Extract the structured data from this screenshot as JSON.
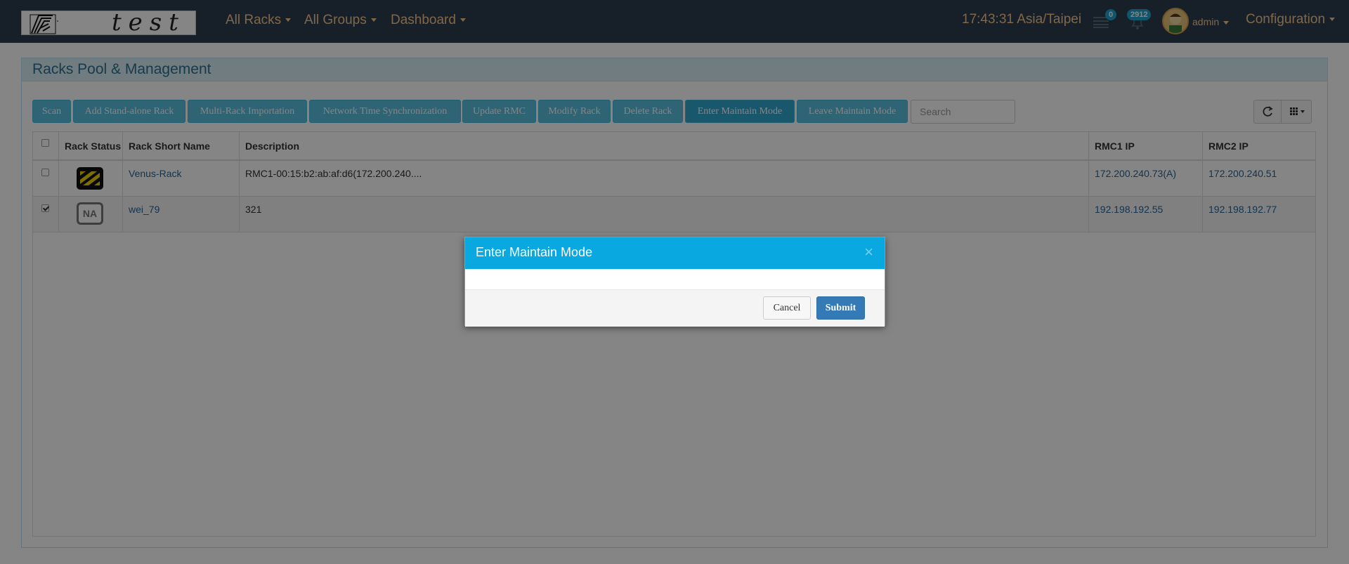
{
  "nav": {
    "logo_text": "test",
    "menu": [
      {
        "label": "All Racks"
      },
      {
        "label": "All Groups"
      },
      {
        "label": "Dashboard"
      }
    ],
    "clock": "17:43:31 Asia/Taipei",
    "messages_badge": "0",
    "alerts_badge": "2912",
    "user": "admin",
    "configuration": "Configuration",
    "colors": {
      "bg": "#2c3e50",
      "text": "#f7c68a",
      "badge": "#21a4d2"
    }
  },
  "panel": {
    "title": "Racks Pool & Management"
  },
  "toolbar": {
    "buttons": [
      {
        "label": "Scan"
      },
      {
        "label": "Add Stand-alone Rack"
      },
      {
        "label": "Multi-Rack Importation"
      },
      {
        "label": "Network Time Synchronization"
      },
      {
        "label": "Update RMC"
      },
      {
        "label": "Modify Rack"
      },
      {
        "label": "Delete Rack"
      },
      {
        "label": "Enter Maintain Mode"
      },
      {
        "label": "Leave Maintain Mode"
      }
    ],
    "search_placeholder": "Search",
    "refresh_icon": "refresh-icon",
    "columns_icon": "grid-columns-icon"
  },
  "table": {
    "headers": {
      "status": "Rack Status",
      "name": "Rack Short Name",
      "description": "Description",
      "rmc1": "RMC1 IP",
      "rmc2": "RMC2 IP"
    },
    "rows": [
      {
        "checked": false,
        "status_icon": "warning-stripes-icon",
        "name": "Venus-Rack",
        "description": "RMC1-00:15:b2:ab:af:d6(172.200.240....",
        "rmc1": "172.200.240.73(A)",
        "rmc2": "172.200.240.51"
      },
      {
        "checked": true,
        "status_icon": "na-status-icon",
        "status_text": "NA",
        "name": "wei_79",
        "description": "321",
        "rmc1": "192.198.192.55",
        "rmc2": "192.198.192.77"
      }
    ]
  },
  "modal": {
    "title": "Enter Maintain Mode",
    "close": "×",
    "cancel": "Cancel",
    "submit": "Submit",
    "header_color": "#0aa8e0"
  }
}
